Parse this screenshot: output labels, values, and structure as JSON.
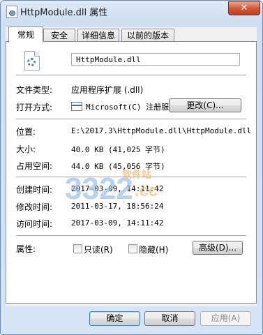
{
  "window": {
    "title": "HttpModule.dll 属性",
    "close_label": "✕"
  },
  "tabs": [
    {
      "label": "常规"
    },
    {
      "label": "安全"
    },
    {
      "label": "详细信息"
    },
    {
      "label": "以前的版本"
    }
  ],
  "general": {
    "file_name": "HttpModule.dll",
    "file_type_label": "文件类型:",
    "file_type_value": "应用程序扩展 (.dll)",
    "open_with_label": "打开方式:",
    "open_with_value": "Microsoft(C) 注册服",
    "change_button": "更改(C)...",
    "location_label": "位置:",
    "location_value": "E:\\2017.3\\HttpModule.dll\\HttpModule.dll",
    "size_label": "大小:",
    "size_value": "40.0 KB (41,025 字节)",
    "size_on_disk_label": "占用空间:",
    "size_on_disk_value": "44.0 KB (45,056 字节)",
    "created_label": "创建时间:",
    "created_value": "2017-03-09, 14:11:42",
    "modified_label": "修改时间:",
    "modified_value": "2011-03-17, 18:56:24",
    "accessed_label": "访问时间:",
    "accessed_value": "2017-03-09, 14:11:42",
    "attributes_label": "属性:",
    "readonly_label": "只读(R)",
    "hidden_label": "隐藏(H)",
    "advanced_button": "高级(D)..."
  },
  "footer": {
    "ok": "确定",
    "cancel": "取消",
    "apply": "应用(A)"
  },
  "watermark": {
    "big": "3322",
    "small": "软件站",
    "suffix": ".cc"
  }
}
